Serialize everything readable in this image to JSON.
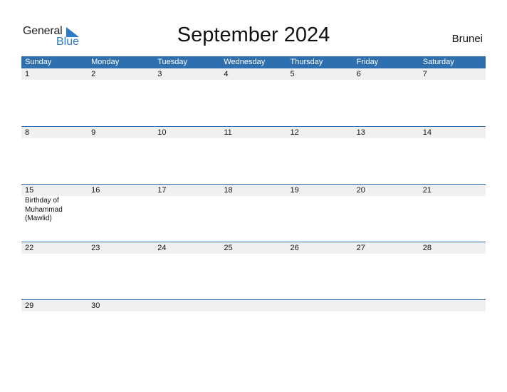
{
  "logo": {
    "word1": "General",
    "word2": "Blue",
    "accent_color": "#2a7bc4"
  },
  "title": "September 2024",
  "country": "Brunei",
  "header_color": "#2e6fb0",
  "weekdays": [
    "Sunday",
    "Monday",
    "Tuesday",
    "Wednesday",
    "Thursday",
    "Friday",
    "Saturday"
  ],
  "weeks": [
    {
      "days": [
        "1",
        "2",
        "3",
        "4",
        "5",
        "6",
        "7"
      ],
      "events": [
        "",
        "",
        "",
        "",
        "",
        "",
        ""
      ]
    },
    {
      "days": [
        "8",
        "9",
        "10",
        "11",
        "12",
        "13",
        "14"
      ],
      "events": [
        "",
        "",
        "",
        "",
        "",
        "",
        ""
      ]
    },
    {
      "days": [
        "15",
        "16",
        "17",
        "18",
        "19",
        "20",
        "21"
      ],
      "events": [
        "Birthday of Muhammad (Mawlid)",
        "",
        "",
        "",
        "",
        "",
        ""
      ]
    },
    {
      "days": [
        "22",
        "23",
        "24",
        "25",
        "26",
        "27",
        "28"
      ],
      "events": [
        "",
        "",
        "",
        "",
        "",
        "",
        ""
      ]
    },
    {
      "days": [
        "29",
        "30",
        "",
        "",
        "",
        "",
        ""
      ],
      "events": [
        "",
        "",
        "",
        "",
        "",
        "",
        ""
      ]
    }
  ]
}
